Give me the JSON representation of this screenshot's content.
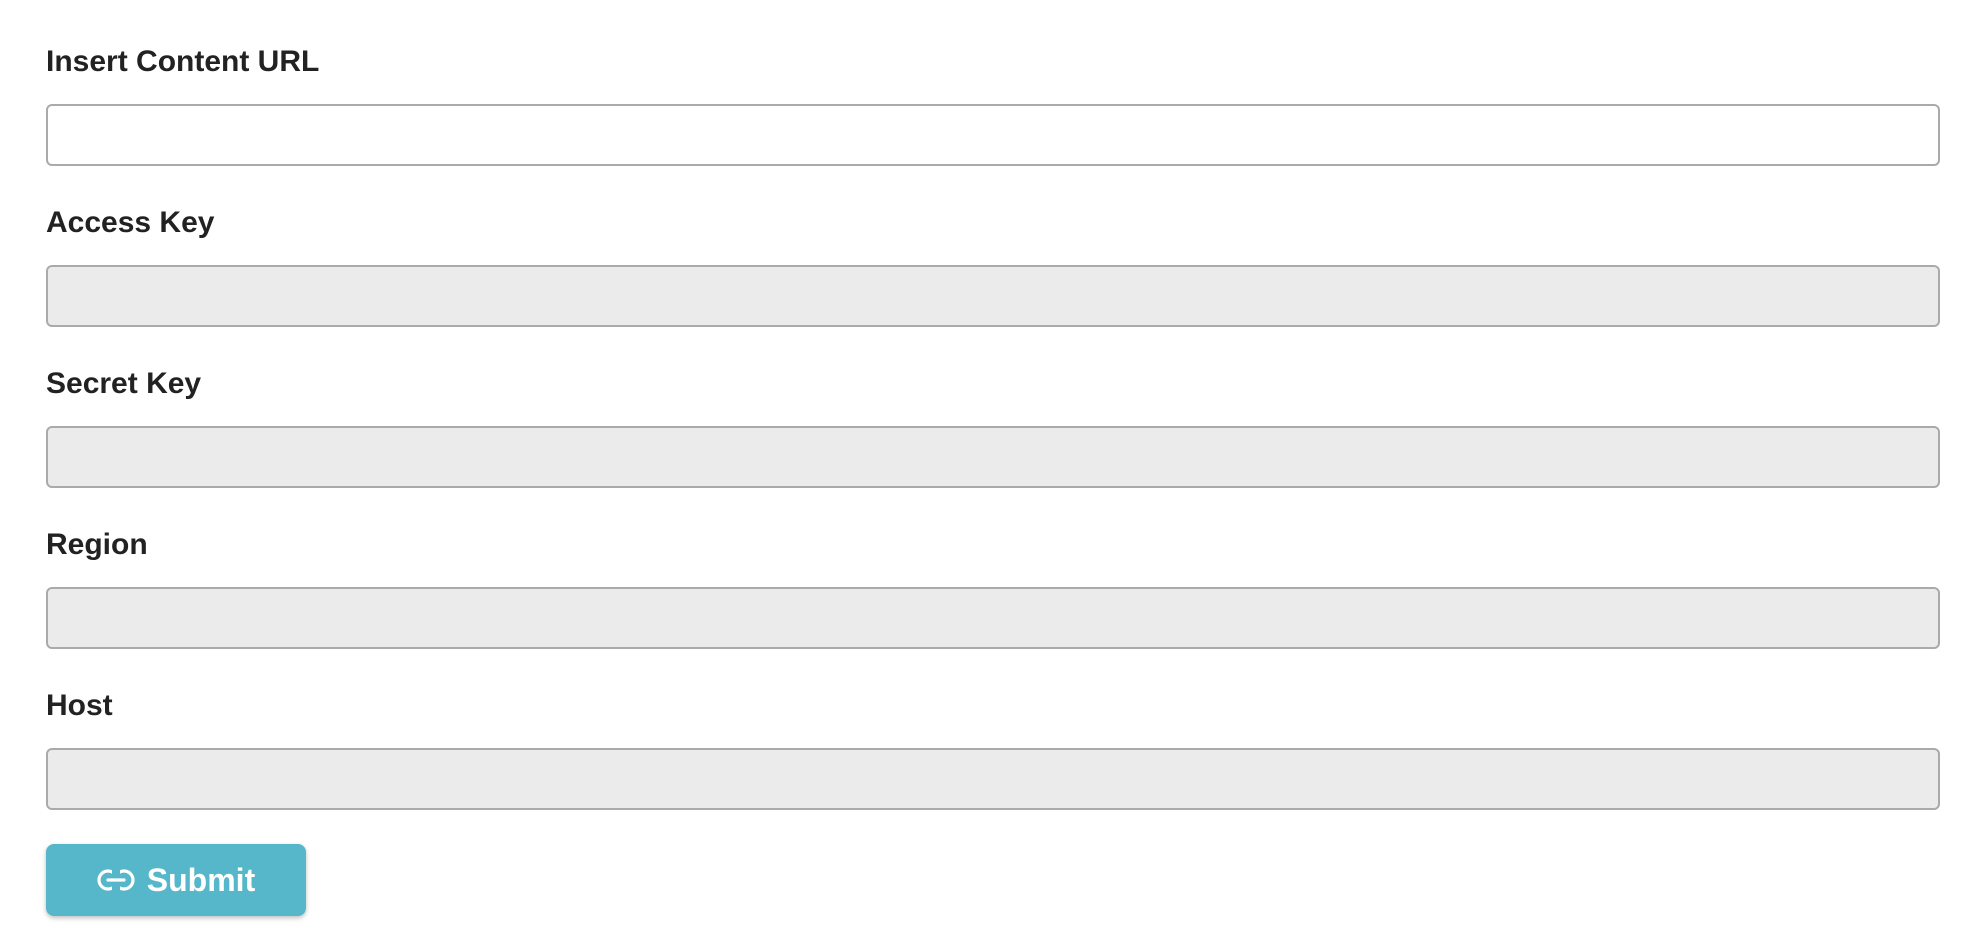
{
  "form": {
    "fields": [
      {
        "label": "Insert Content URL",
        "value": "",
        "placeholder": "",
        "disabled": false
      },
      {
        "label": "Access Key",
        "value": "",
        "placeholder": "",
        "disabled": true
      },
      {
        "label": "Secret Key",
        "value": "",
        "placeholder": "",
        "disabled": true
      },
      {
        "label": "Region",
        "value": "",
        "placeholder": "",
        "disabled": true
      },
      {
        "label": "Host",
        "value": "",
        "placeholder": "",
        "disabled": true
      }
    ],
    "submit": {
      "label": "Submit",
      "icon": "link-icon"
    }
  },
  "colors": {
    "submit_background": "#55b7c9",
    "disabled_input_background": "#ebebeb",
    "input_border": "#aaaaaa",
    "label_text": "#222222"
  }
}
